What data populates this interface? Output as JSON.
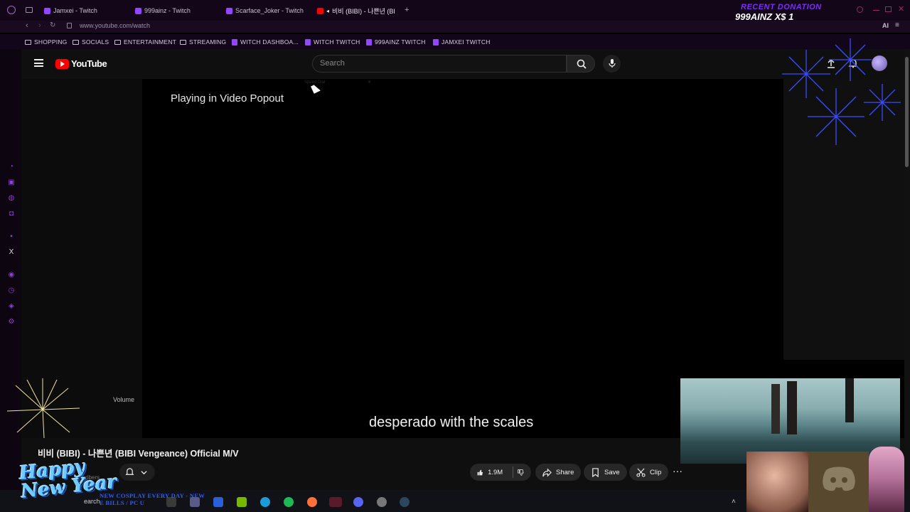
{
  "browser": {
    "tabs": [
      {
        "label": "Jamxei - Twitch",
        "active": false
      },
      {
        "label": "999ainz - Twitch",
        "active": false
      },
      {
        "label": "Scarface_Joker - Twitch",
        "active": false
      },
      {
        "label": "비비 (BIBI) - 나쁜년 (BI",
        "active": true
      }
    ],
    "new_tab": "+",
    "url": "www.youtube.com/watch",
    "bookmarks": [
      {
        "label": "SHOPPING",
        "icon": "folder-icon"
      },
      {
        "label": "SOCIALS",
        "icon": "folder-icon"
      },
      {
        "label": "ENTERTAINMENT",
        "icon": "folder-icon"
      },
      {
        "label": "STREAMING",
        "icon": "folder-icon"
      },
      {
        "label": "WITCH DASHBOA...",
        "icon": "twitch-icon"
      },
      {
        "label": "WITCH TWITCH",
        "icon": "twitch-icon"
      },
      {
        "label": "999AINZ TWITCH",
        "icon": "twitch-icon"
      },
      {
        "label": "JAMXEI TWITCH",
        "icon": "twitch-icon"
      }
    ],
    "ai_label": "AI"
  },
  "youtube": {
    "logo_text": "YouTube",
    "search_placeholder": "Search",
    "popout_message": "Playing in Video Popout",
    "speed_dial": "Speed Dial",
    "subtitle": "desperado with the scales",
    "volume_label": "Volume",
    "video_title": "비비 (BIBI) - 나쁜년 (BIBI Vengeance) Official M/V",
    "subscribers_fragment": "ribers",
    "like_count": "1.9M",
    "share_label": "Share",
    "save_label": "Save",
    "clip_label": "Clip",
    "more_label": "···"
  },
  "overlay": {
    "donation_title": "RECENT DONATION",
    "donation_name": "999AINZ X$ 1",
    "greeting_line1": "Happy",
    "greeting_line2": "New Year",
    "ticker_line1": "NEW COSPLAY EVERY DAY - NEW",
    "ticker_line2": "E BILLS / PC U",
    "taskbar_search": "earch"
  },
  "colors": {
    "browser_accent": "#9146ff",
    "youtube_red": "#ff0000",
    "donation_purple": "#7d2cff",
    "ticker_blue": "#2e5bff"
  }
}
